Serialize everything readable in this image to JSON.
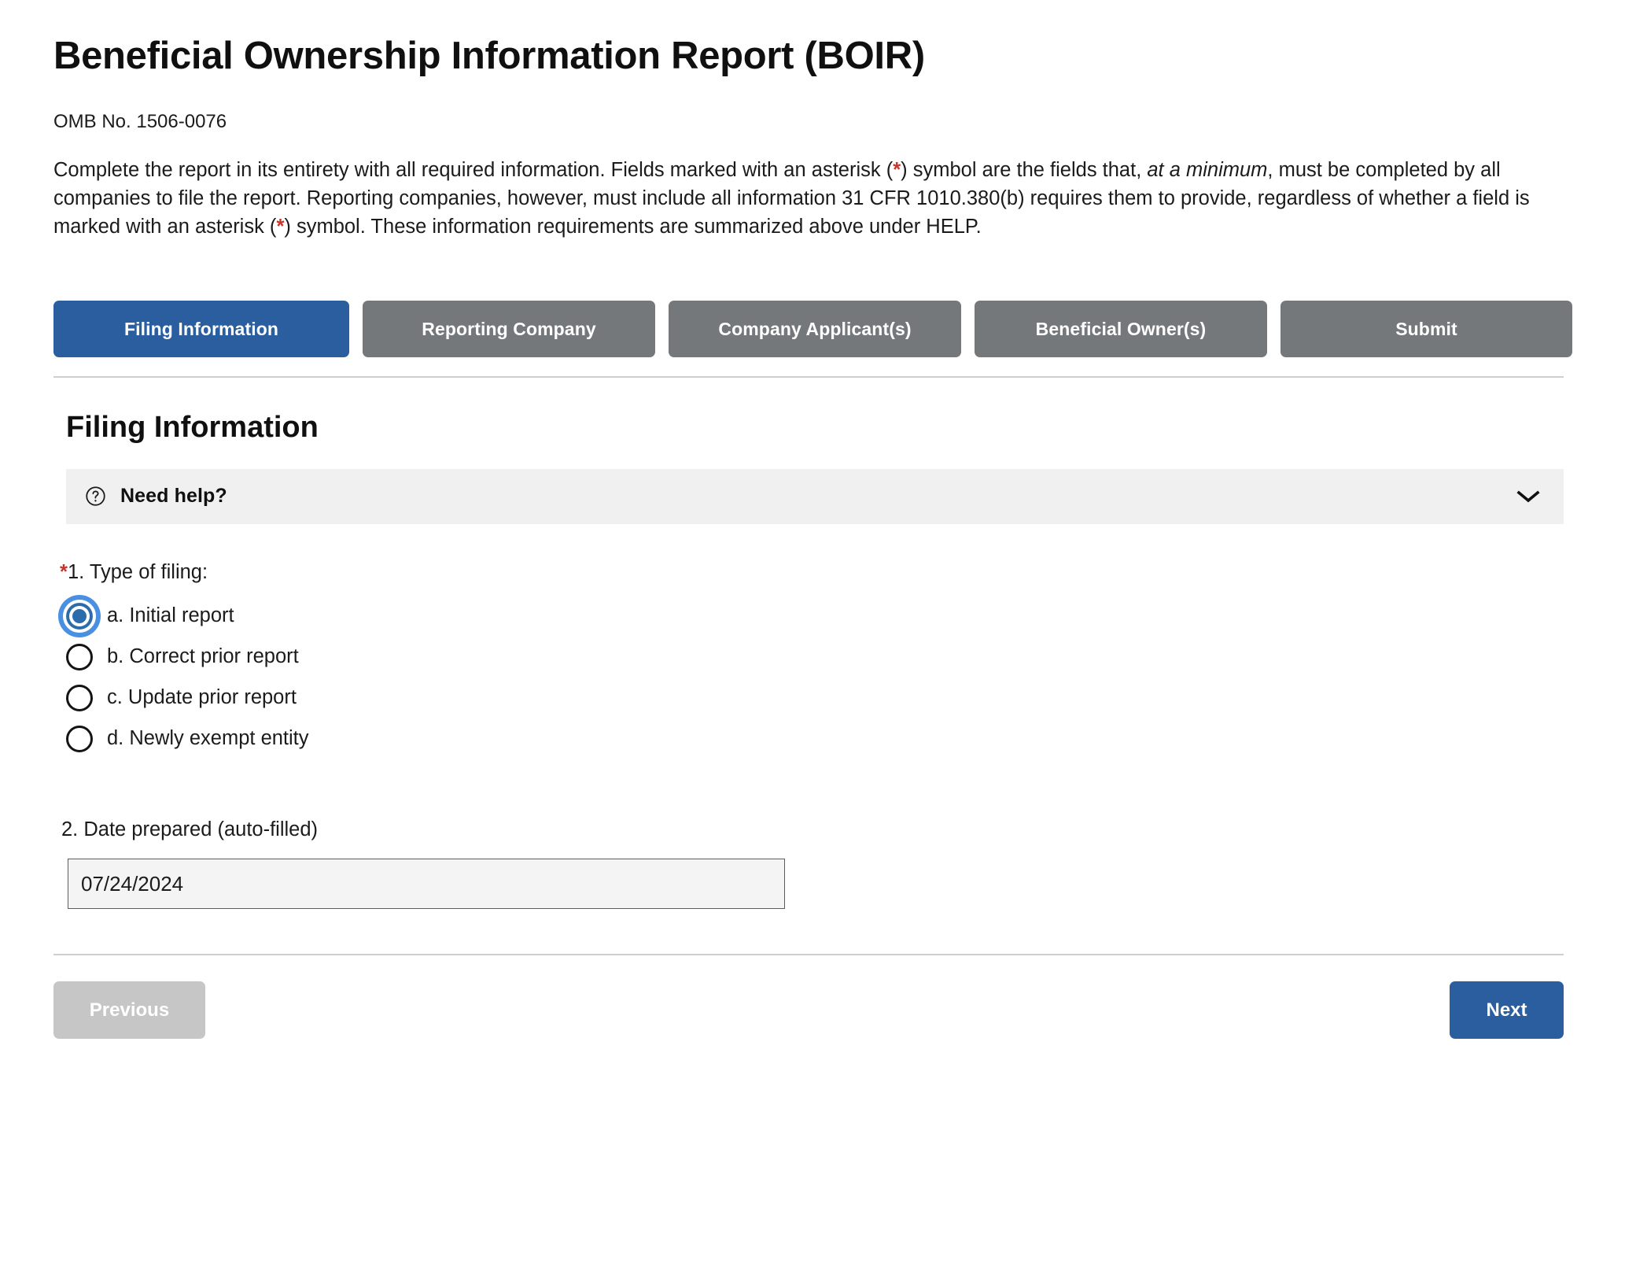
{
  "header": {
    "title": "Beneficial Ownership Information Report (BOIR)",
    "omb": "OMB No. 1506-0076",
    "intro": {
      "part1": "Complete the report in its entirety with all required information. Fields marked with an asterisk (",
      "star1": "*",
      "part2": ") symbol are the fields that, ",
      "italic1": "at a minimum",
      "part3": ", must be completed by all companies to file the report. Reporting companies, however, must include all information 31 CFR 1010.380(b) requires them to provide, regardless of whether a field is marked with an asterisk (",
      "star2": "*",
      "part4": ") symbol. These information requirements are summarized above under HELP."
    }
  },
  "colors": {
    "active_tab": "#2a5e9e",
    "inactive_tab": "#75787b",
    "required_star": "#c7352a",
    "primary_button": "#2a5e9e",
    "disabled_button": "#c6c6c6",
    "radio_focus_ring": "#4a90e2",
    "radio_fill": "#2d6cab",
    "help_bar_bg": "#f0f0f0",
    "input_bg": "#f4f4f4"
  },
  "tabs": [
    {
      "label": "Filing Information",
      "active": true
    },
    {
      "label": "Reporting Company",
      "active": false
    },
    {
      "label": "Company Applicant(s)",
      "active": false
    },
    {
      "label": "Beneficial Owner(s)",
      "active": false
    },
    {
      "label": "Submit",
      "active": false
    }
  ],
  "section": {
    "title": "Filing Information",
    "help": {
      "label": "Need help?",
      "help_icon": "question-circle-icon",
      "expand_icon": "chevron-down-icon",
      "expanded": false
    }
  },
  "question1": {
    "required_marker": "*",
    "label": "1. Type of filing:",
    "options": [
      {
        "label": "a. Initial report",
        "selected": true
      },
      {
        "label": "b. Correct prior report",
        "selected": false
      },
      {
        "label": "c. Update prior report",
        "selected": false
      },
      {
        "label": "d. Newly exempt entity",
        "selected": false
      }
    ]
  },
  "question2": {
    "label": "2. Date prepared (auto-filled)",
    "value": "07/24/2024",
    "placeholder": ""
  },
  "footer": {
    "previous_label": "Previous",
    "previous_disabled": true,
    "next_label": "Next"
  }
}
